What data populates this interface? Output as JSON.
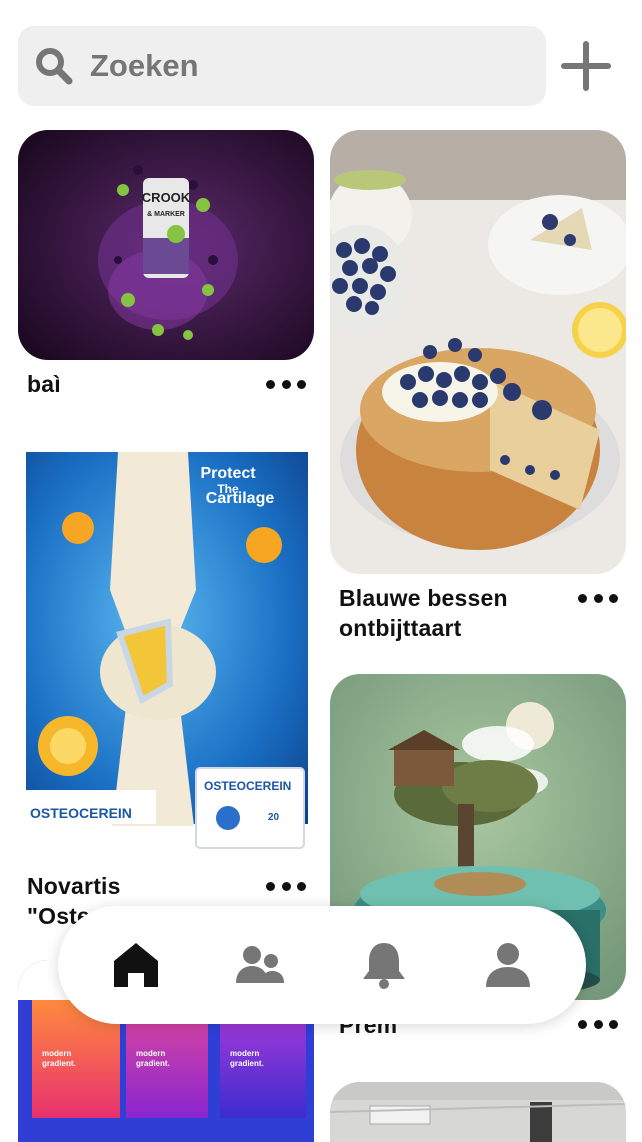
{
  "search": {
    "placeholder": "Zoeken",
    "icon": "search-icon"
  },
  "header": {
    "add_icon": "plus-icon"
  },
  "pins": [
    {
      "title": "baì",
      "image": "crook-drink-can-splash"
    },
    {
      "title": "Blauwe bessen ontbijttaart",
      "image": "blueberry-cake"
    },
    {
      "title": "Novartis \"Osteocerein\"",
      "image": "knee-cartilage-ad",
      "ad_headline_1": "Protect",
      "ad_headline_2": "The",
      "ad_headline_3": "Cartilage",
      "brand": "OSTEOCEREIN",
      "dose": "20"
    },
    {
      "title": "Prem",
      "image": "treehouse-island"
    },
    {
      "title": "",
      "image": "modern-gradient-posters",
      "poster_text_1": "modern",
      "poster_text_2": "gradient."
    },
    {
      "title": "",
      "image": "office-ceiling"
    }
  ],
  "can": {
    "brand": "CROOK",
    "sub": "& MARKER"
  },
  "nav": [
    {
      "name": "home",
      "icon": "home-icon",
      "active": true
    },
    {
      "name": "following",
      "icon": "people-icon",
      "active": false
    },
    {
      "name": "notifications",
      "icon": "bell-icon",
      "active": false
    },
    {
      "name": "profile",
      "icon": "profile-icon",
      "active": false
    }
  ],
  "colors": {
    "nav_active": "#111111",
    "nav_inactive": "#767676",
    "search_bg": "#efefef"
  }
}
